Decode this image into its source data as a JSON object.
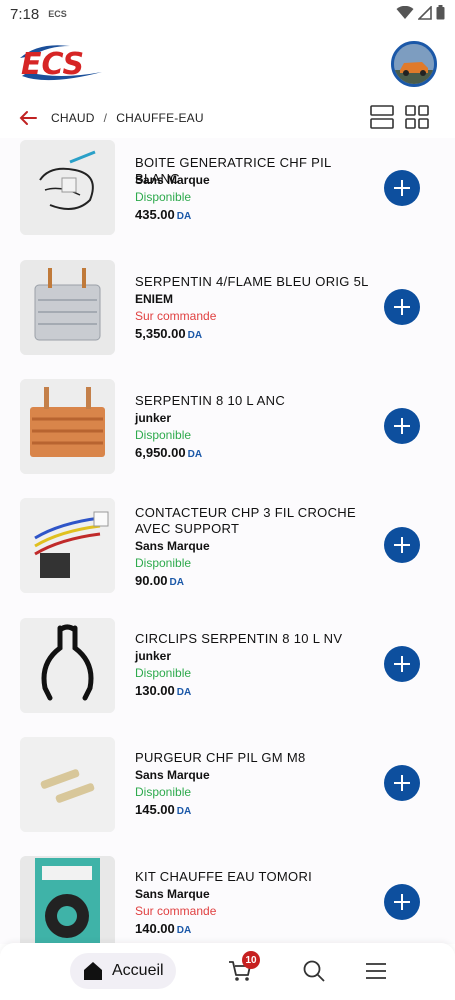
{
  "status": {
    "time": "7:18",
    "app": "ECS"
  },
  "brand": {
    "accent": "#0d4f9e",
    "available_color": "#2eaa4d",
    "order_color": "#e04141"
  },
  "breadcrumb": {
    "parent": "CHAUD",
    "separator": "/",
    "current": "CHAUFFE-EAU"
  },
  "products": [
    {
      "title": "BOITE GENERATRICE CHF PIL BLANC",
      "brand": "Sans Marque",
      "availability": "Disponible",
      "price": "435.00",
      "currency": "DA"
    },
    {
      "title": "SERPENTIN 4/FLAME BLEU ORIG 5L",
      "brand": "ENIEM",
      "availability": "Sur commande",
      "price": "5,350.00",
      "currency": "DA"
    },
    {
      "title": "SERPENTIN 8 10 L ANC",
      "brand": "junker",
      "availability": "Disponible",
      "price": "6,950.00",
      "currency": "DA"
    },
    {
      "title": "CONTACTEUR CHP 3 FIL CROCHE AVEC SUPPORT",
      "brand": "Sans Marque",
      "availability": "Disponible",
      "price": "90.00",
      "currency": "DA"
    },
    {
      "title": "CIRCLIPS SERPENTIN 8 10 L NV",
      "brand": "junker",
      "availability": "Disponible",
      "price": "130.00",
      "currency": "DA"
    },
    {
      "title": "PURGEUR CHF PIL GM M8",
      "brand": "Sans Marque",
      "availability": "Disponible",
      "price": "145.00",
      "currency": "DA"
    },
    {
      "title": "KIT CHAUFFE EAU TOMORI",
      "brand": "Sans Marque",
      "availability": "Sur commande",
      "price": "140.00",
      "currency": "DA"
    }
  ],
  "nav": {
    "home_label": "Accueil",
    "cart_count": "10"
  },
  "icons": [
    "back-arrow-icon",
    "list-view-icon",
    "grid-view-icon",
    "plus-icon",
    "home-icon",
    "cart-icon",
    "search-icon",
    "menu-icon",
    "wifi-icon",
    "signal-icon",
    "battery-icon"
  ]
}
